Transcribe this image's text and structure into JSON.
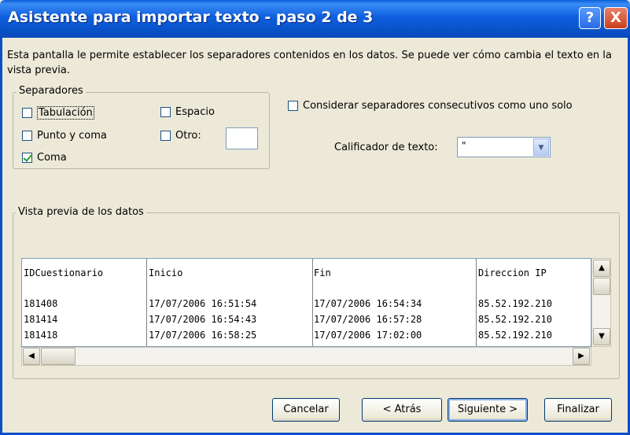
{
  "window": {
    "title": "Asistente para importar texto - paso 2 de 3",
    "help_label": "?",
    "close_label": "X"
  },
  "description": "Esta pantalla le permite establecer los separadores contenidos en los datos. Se puede ver cómo cambia el texto en la vista previa.",
  "separators": {
    "group_label": "Separadores",
    "options": [
      {
        "label": "Tabulación",
        "checked": false
      },
      {
        "label": "Punto y coma",
        "checked": false
      },
      {
        "label": "Coma",
        "checked": true
      },
      {
        "label": "Espacio",
        "checked": false
      },
      {
        "label": "Otro:",
        "checked": false
      }
    ],
    "consecutive": {
      "label": "Considerar separadores consecutivos como uno solo",
      "checked": false
    },
    "qualifier_label": "Calificador de texto:",
    "qualifier_value": "\""
  },
  "preview": {
    "group_label": "Vista previa de los datos",
    "columns": [
      "IDCuestionario",
      "Inicio",
      "Fin",
      "Direccion IP"
    ],
    "rows": [
      [
        "181408",
        "17/07/2006 16:51:54",
        "17/07/2006 16:54:34",
        "85.52.192.210"
      ],
      [
        "181414",
        "17/07/2006 16:54:43",
        "17/07/2006 16:57:28",
        "85.52.192.210"
      ],
      [
        "181418",
        "17/07/2006 16:58:25",
        "17/07/2006 17:02:00",
        "85.52.192.210"
      ]
    ]
  },
  "buttons": {
    "cancel": "Cancelar",
    "back": "< Atrás",
    "next": "Siguiente >",
    "finish": "Finalizar"
  }
}
